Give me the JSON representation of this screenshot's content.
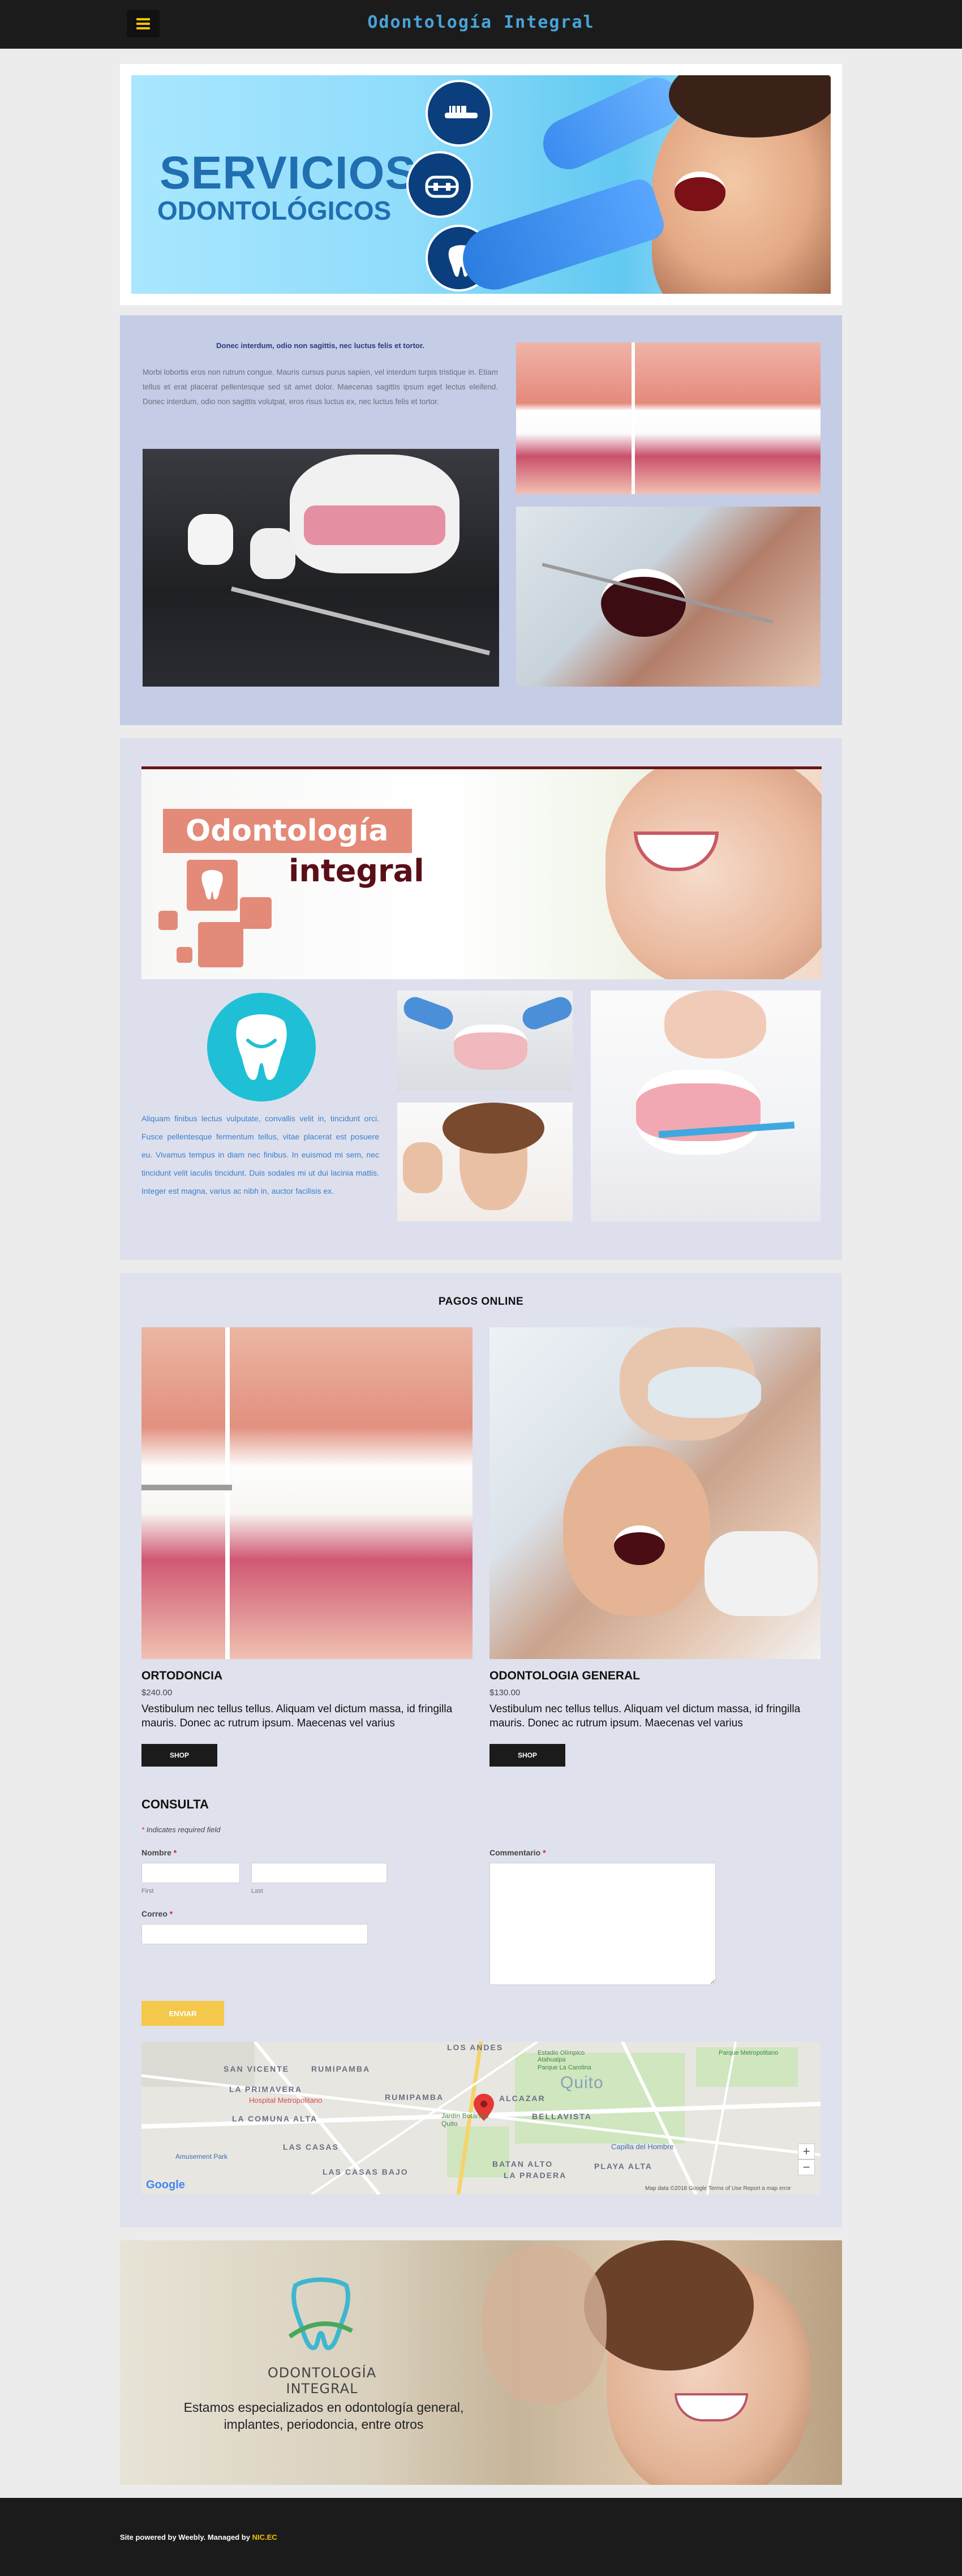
{
  "header": {
    "site_title": "Odontología Integral",
    "menu_icon": "hamburger-menu-icon",
    "accent": "#f2c300",
    "title_color": "#4aa3d8"
  },
  "banner1": {
    "title": "SERVICIOS",
    "subtitle": "ODONTOLÓGICOS",
    "icons": [
      "toothbrush-icon",
      "braces-icon",
      "tooth-icon"
    ]
  },
  "section2": {
    "heading": "Donec interdum, odio non sagittis, nec luctus felis et tortor.",
    "paragraph": "Morbi lobortis eros non rutrum congue. Mauris cursus purus sapien, vel interdum turpis tristique in. Etiam tellus et erat placerat pellentesque sed sit amet dolor. Maecenas sagittis ipsum eget lectus eleifend. Donec interdum, odio non sagittis volutpat, eros risus luctus ex, nec luctus felis et tortor."
  },
  "section3": {
    "banner_title": "Odontología",
    "banner_subtitle": "integral",
    "paragraph": "Aliquam finibus lectus vulputate, convallis velit in, tincidunt orci. Fusce pellentesque fermentum tellus, vitae placerat est posuere eu. Vivamus tempus in diam nec finibus. In euismod mi sem, nec tincidunt velit iaculis tincidunt. Duis sodales mi ut dui lacinia mattis. Integer est magna, varius ac nibh in, auctor facilisis ex."
  },
  "store": {
    "heading": "PAGOS ONLINE",
    "products": [
      {
        "name": "ORTODONCIA",
        "price": "$240.00",
        "description": "Vestibulum nec tellus tellus. Aliquam vel dictum massa, id fringilla mauris. Donec ac rutrum ipsum. Maecenas vel varius",
        "button": "SHOP"
      },
      {
        "name": "ODONTOLOGIA GENERAL",
        "price": "$130.00",
        "description": "Vestibulum nec tellus tellus. Aliquam vel dictum massa, id fringilla mauris. Donec ac rutrum ipsum. Maecenas vel varius",
        "button": "SHOP"
      }
    ]
  },
  "form": {
    "title": "CONSULTA",
    "required_note": "Indicates required field",
    "required_star": "*",
    "nombre_label": "Nombre",
    "first_label": "First",
    "last_label": "Last",
    "correo_label": "Correo",
    "comment_label": "Commentario",
    "first_value": "",
    "last_value": "",
    "correo_value": "",
    "comment_value": "",
    "submit": "ENVIAR",
    "submit_color": "#f4c84a"
  },
  "map": {
    "labels": [
      "LOS ANDES",
      "SAN VICENTE",
      "RUMIPAMBA",
      "LA PRIMAVERA",
      "Hospital Metropolitano",
      "RUMIPAMBA",
      "ALCAZAR",
      "Quito",
      "Jardín Botánico Quito",
      "BELLAVISTA",
      "LA COMUNA ALTA",
      "LAS CASAS",
      "Capilla del Hombre",
      "Amusement Park",
      "LAS CASAS BAJO",
      "BATAN ALTO",
      "PLAYA ALTA",
      "LA PRADERA",
      "Estadio Olímpico Atahualpa",
      "Parque La Carolina",
      "Parque Metropolitano",
      "Google"
    ],
    "footer_note": "Map data ©2018 Google   Terms of Use   Report a map error",
    "zoom_in": "+",
    "zoom_out": "−"
  },
  "section5": {
    "brand_line1": "ODONTOLOGÍA",
    "brand_line2": "INTEGRAL",
    "tagline": "Estamos especializados en odontología general, implantes, periodoncia, entre otros"
  },
  "footer": {
    "text": "Site powered by Weebly. Managed by ",
    "link": "NIC.EC"
  }
}
